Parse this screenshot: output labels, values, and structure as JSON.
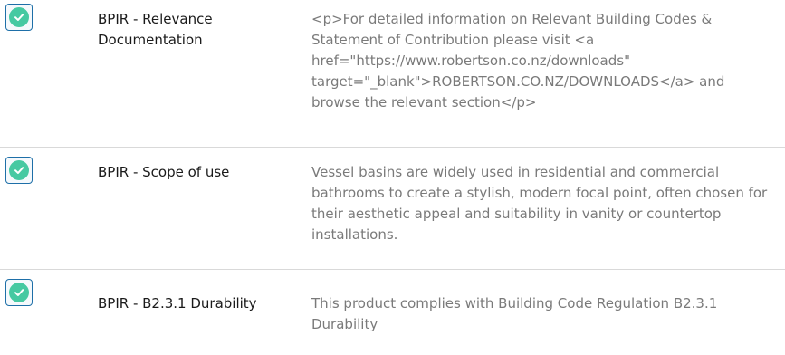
{
  "rows": [
    {
      "status_icon": "check-circle-icon",
      "label": "BPIR - Relevance Documentation",
      "value": "<p>For detailed information on Relevant Building Codes & Statement of Contribution please visit <a href=\"https://www.robertson.co.nz/downloads\" target=\"_blank\">ROBERTSON.CO.NZ/DOWNLOADS</a> and browse the relevant section</p>"
    },
    {
      "status_icon": "check-circle-icon",
      "label": "BPIR - Scope of use",
      "value": "Vessel basins are widely used in residential and commercial bathrooms to create a stylish, modern focal point, often chosen for their aesthetic appeal and suitability in vanity or countertop installations."
    },
    {
      "status_icon": "check-circle-icon",
      "label": "BPIR - B2.3.1 Durability",
      "value": "This product complies with Building Code Regulation B2.3.1 Durability"
    }
  ],
  "colors": {
    "check_fill": "#46c9a2",
    "check_border": "#1e6fa8",
    "label_text": "#1a1a1a",
    "value_text": "#7a7a7a",
    "divider": "#d9d9d9"
  }
}
